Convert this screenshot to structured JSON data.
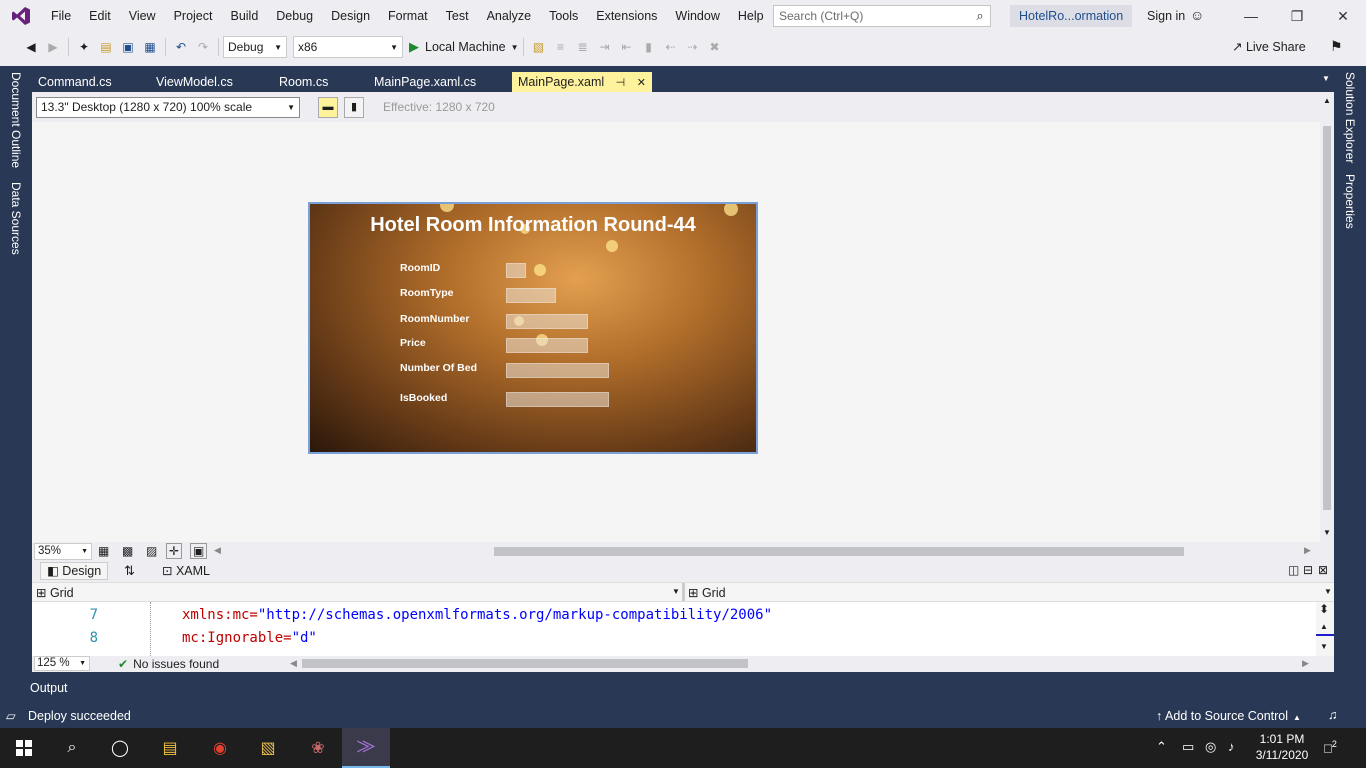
{
  "menu": {
    "items": [
      "File",
      "Edit",
      "View",
      "Project",
      "Build",
      "Debug",
      "Design",
      "Format",
      "Test",
      "Analyze",
      "Tools",
      "Extensions",
      "Window",
      "Help"
    ],
    "search_placeholder": "Search (Ctrl+Q)",
    "project_title": "HotelRo...ormation",
    "signin": "Sign in"
  },
  "toolbar": {
    "configuration": "Debug",
    "platform": "x86",
    "run_label": "Local Machine",
    "live_share": "Live Share"
  },
  "side_panels": {
    "left": [
      "Document Outline",
      "Data Sources"
    ],
    "right": [
      "Solution Explorer",
      "Properties"
    ]
  },
  "tabs": [
    {
      "label": "Command.cs",
      "active": false
    },
    {
      "label": "ViewModel.cs",
      "active": false
    },
    {
      "label": "Room.cs",
      "active": false
    },
    {
      "label": "MainPage.xaml.cs",
      "active": false
    },
    {
      "label": "MainPage.xaml",
      "active": true
    }
  ],
  "designer": {
    "device": "13.3\" Desktop (1280 x 720) 100% scale",
    "effective": "Effective: 1280 x 720",
    "zoom": "35%"
  },
  "app_preview": {
    "title": "Hotel Room Information Round-44",
    "fields": [
      "RoomID",
      "RoomType",
      "RoomNumber",
      "Price",
      "Number Of Bed",
      "IsBooked"
    ]
  },
  "split": {
    "design_tab": "Design",
    "xaml_tab": "XAML",
    "crumb_left": "Grid",
    "crumb_right": "Grid"
  },
  "code": {
    "lines": [
      {
        "no": "7",
        "attr": "xmlns:mc=",
        "value": "\"http://schemas.openxmlformats.org/markup-compatibility/2006\""
      },
      {
        "no": "8",
        "attr": "mc:Ignorable=",
        "value": "\"d\""
      }
    ],
    "zoom": "125 %",
    "issues": "No issues found"
  },
  "output_tab": "Output",
  "status": {
    "deploy": "Deploy succeeded",
    "source_control": "Add to Source Control"
  },
  "taskbar": {
    "time": "1:01 PM",
    "date": "3/11/2020",
    "notification_count": "2"
  },
  "colors": {
    "vs_blue": "#293955",
    "active_tab": "#fff29d",
    "accent_purple": "#68217a"
  }
}
